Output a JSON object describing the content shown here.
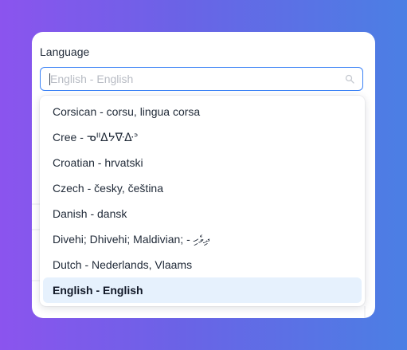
{
  "language_field": {
    "label": "Language",
    "placeholder": "English - English",
    "search_icon": "search-icon"
  },
  "dropdown": {
    "options": [
      {
        "label": "Corsican - corsu, lingua corsa",
        "selected": false
      },
      {
        "label": "Cree - ᓀᐦᐃᔭᐍᐏᐣ",
        "selected": false
      },
      {
        "label": "Croatian - hrvatski",
        "selected": false
      },
      {
        "label": "Czech - česky, čeština",
        "selected": false
      },
      {
        "label": "Danish - dansk",
        "selected": false
      },
      {
        "label": "Divehi; Dhivehi; Maldivian; - ދިވެހި",
        "selected": false
      },
      {
        "label": "Dutch - Nederlands, Vlaams",
        "selected": false
      },
      {
        "label": "English - English",
        "selected": true
      }
    ]
  },
  "colors": {
    "accent_border": "#3b82f6",
    "selected_bg": "#e6f1fd"
  }
}
